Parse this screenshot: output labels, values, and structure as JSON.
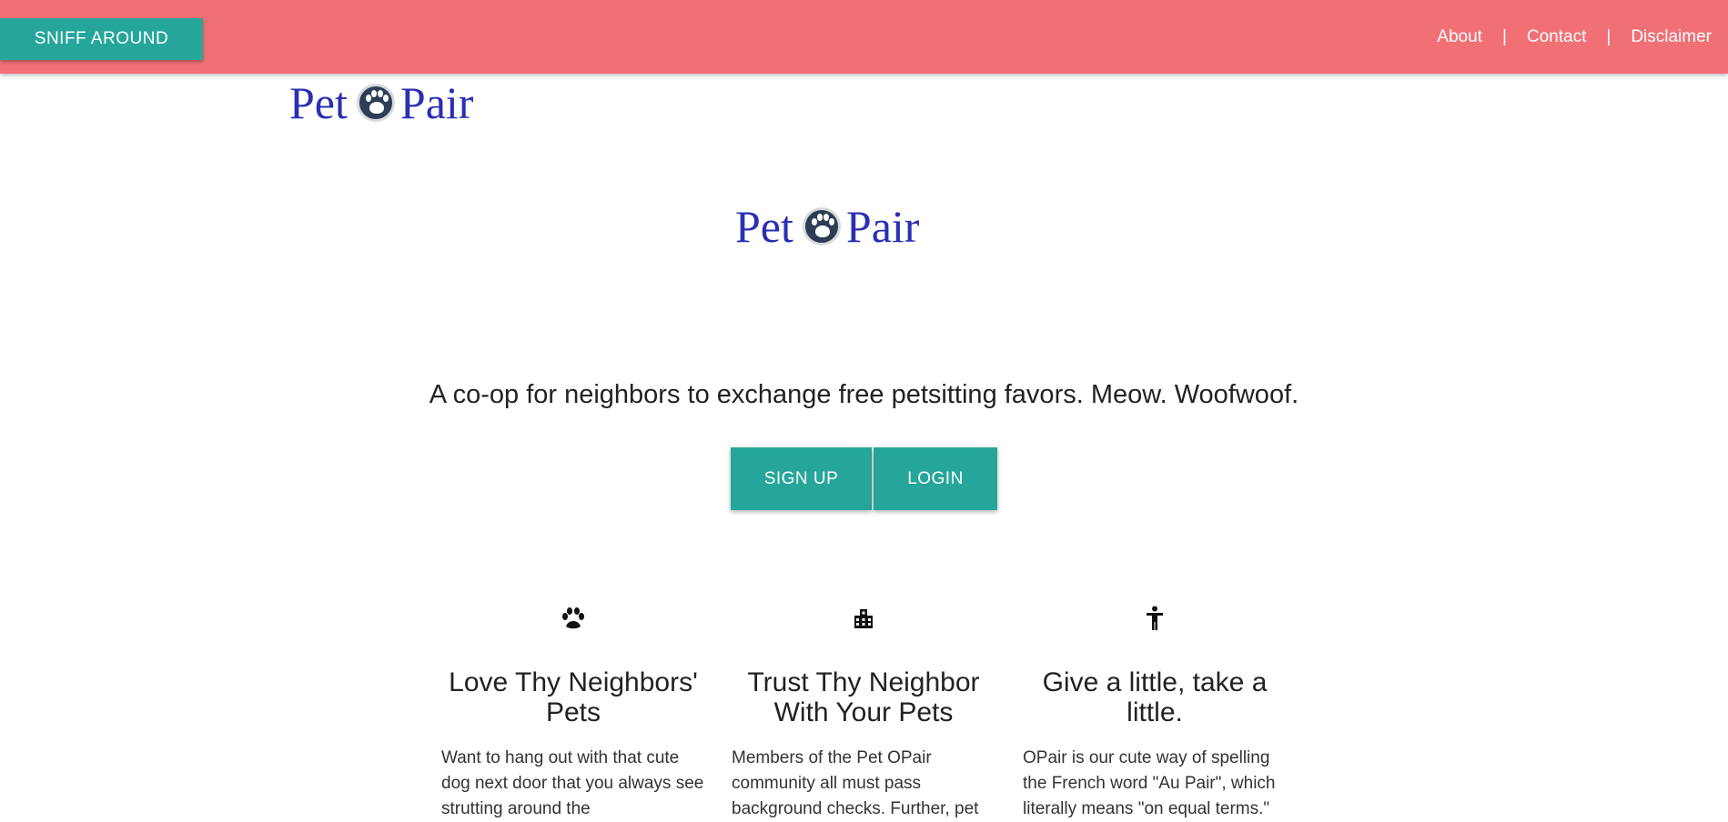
{
  "nav": {
    "sniff_button": "SNIFF AROUND",
    "links": [
      "About",
      "Contact",
      "Disclaimer"
    ],
    "separator": "|"
  },
  "logo": {
    "word1": "Pet",
    "word2": "Pair",
    "icon": "paw-icon"
  },
  "hero": {
    "tagline": "A co-op for neighbors to exchange free petsitting favors. Meow. Woofwoof.",
    "signup_label": "SIGN UP",
    "login_label": "LOGIN"
  },
  "features": [
    {
      "icon": "paw-icon",
      "title": "Love Thy Neighbors' Pets",
      "text": "Want to hang out with that cute dog next door that you always see strutting around the"
    },
    {
      "icon": "building-icon",
      "title": "Trust Thy Neighbor With Your Pets",
      "text": "Members of the Pet OPair community all must pass background checks. Further, pet"
    },
    {
      "icon": "accessibility-icon",
      "title": "Give a little, take a little.",
      "text": "OPair is our cute way of spelling the French word \"Au Pair\", which literally means \"on equal terms.\""
    }
  ],
  "colors": {
    "navbar": "#f07076",
    "accent": "#26a69a",
    "logo_text": "#2b2fb3"
  }
}
